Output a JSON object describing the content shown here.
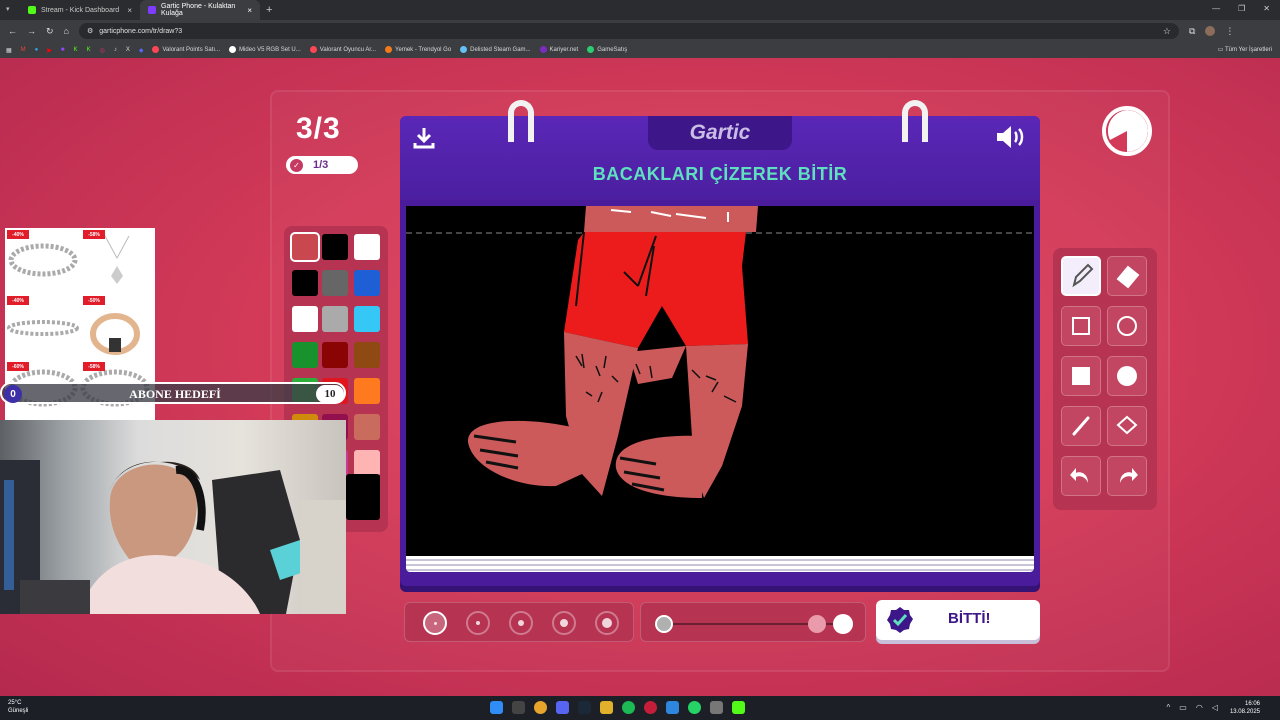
{
  "browser": {
    "tabs": [
      {
        "title": "Stream - Kick Dashboard",
        "active": false
      },
      {
        "title": "Gartic Phone - Kulaktan Kulağa",
        "active": true
      }
    ],
    "url": "garticphone.com/tr/draw?3",
    "bookmarks": [
      {
        "label": "Valorant Points Satı...",
        "color": "#ff4655"
      },
      {
        "label": "Mideo V5 RGB Set U...",
        "color": "#ffffff"
      },
      {
        "label": "Valorant Oyuncu Ar...",
        "color": "#ff4655"
      },
      {
        "label": "Yemek - Trendyol Go",
        "color": "#f27a1a"
      },
      {
        "label": "Delisted Steam Gam...",
        "color": "#66c0f4"
      },
      {
        "label": "Kariyer.net",
        "color": "#7b2cbf"
      },
      {
        "label": "GameSatış",
        "color": "#2ecc71"
      }
    ],
    "bookmarks_right": "Tüm Yer İşaretleri"
  },
  "game": {
    "round": "3/3",
    "progress": "1/3",
    "logo": "Gartic",
    "task": "BACAKLARI ÇİZEREK BİTİR",
    "done_label": "BİTTİ!",
    "palette": [
      {
        "color": "#c9474f",
        "selected": true
      },
      {
        "color": "#000000",
        "selected": false
      },
      {
        "color": "#ffffff",
        "selected": false
      },
      {
        "color": "#000000",
        "selected": false
      },
      {
        "color": "#666666",
        "selected": false
      },
      {
        "color": "#1e5fd6",
        "selected": false
      },
      {
        "color": "#ffffff",
        "selected": false
      },
      {
        "color": "#aaaaaa",
        "selected": false
      },
      {
        "color": "#35c7f5",
        "selected": false
      },
      {
        "color": "#17922c",
        "selected": false
      },
      {
        "color": "#8a0404",
        "selected": false
      },
      {
        "color": "#8e4a12",
        "selected": false
      },
      {
        "color": "#2cb03a",
        "selected": false
      },
      {
        "color": "#e0161f",
        "selected": false
      },
      {
        "color": "#ff7a1f",
        "selected": false
      },
      {
        "color": "#d08a0c",
        "selected": false
      },
      {
        "color": "#93104f",
        "selected": false
      },
      {
        "color": "#c96b5d",
        "selected": false
      },
      {
        "color": "#e9a316",
        "selected": false
      },
      {
        "color": "#cb3a91",
        "selected": false
      },
      {
        "color": "#ffb4b4",
        "selected": false
      }
    ],
    "tools": [
      "pencil-icon",
      "eraser-icon",
      "square-outline-icon",
      "circle-outline-icon",
      "square-filled-icon",
      "circle-filled-icon",
      "line-icon",
      "fill-bucket-icon",
      "undo-icon",
      "redo-icon"
    ],
    "active_tool": "pencil-icon",
    "brush_size_selected": 0,
    "opacity_level": 0.85
  },
  "overlay": {
    "sub_goal_label": "ABONE HEDEFİ",
    "sub_goal_current": "0",
    "sub_goal_target": "10",
    "ad_badges": [
      "-40%",
      "-58%",
      "-40%",
      "-50%",
      "-60%",
      "-58%"
    ]
  },
  "taskbar": {
    "temperature": "25°C",
    "weather": "Güneşli",
    "time": "16:06",
    "date": "13.08.2025"
  }
}
